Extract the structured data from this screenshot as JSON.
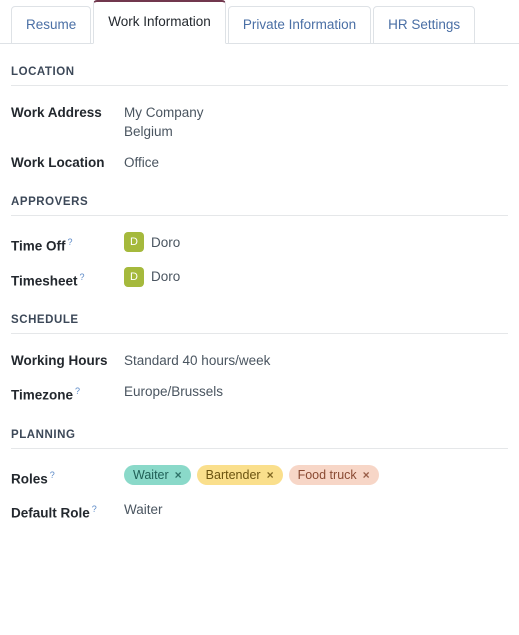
{
  "tabs": [
    {
      "label": "Resume",
      "active": false
    },
    {
      "label": "Work Information",
      "active": true
    },
    {
      "label": "Private Information",
      "active": false
    },
    {
      "label": "HR Settings",
      "active": false
    }
  ],
  "active_tab_accent": "#71374d",
  "sections": [
    {
      "title": "LOCATION",
      "rows": [
        {
          "label": "Work Address",
          "help": false,
          "type": "text-lines",
          "lines": [
            "My Company",
            "Belgium"
          ]
        },
        {
          "label": "Work Location",
          "help": false,
          "type": "text",
          "value": "Office"
        }
      ]
    },
    {
      "title": "APPROVERS",
      "rows": [
        {
          "label": "Time Off",
          "help": true,
          "help_glyph": "?",
          "type": "avatar",
          "avatar_initial": "D",
          "avatar_color": "#a5b93c",
          "value": "Doro"
        },
        {
          "label": "Timesheet",
          "help": true,
          "help_glyph": "?",
          "type": "avatar",
          "avatar_initial": "D",
          "avatar_color": "#a5b93c",
          "value": "Doro"
        }
      ]
    },
    {
      "title": "SCHEDULE",
      "rows": [
        {
          "label": "Working Hours",
          "help": false,
          "type": "text",
          "value": "Standard 40 hours/week"
        },
        {
          "label": "Timezone",
          "help": true,
          "help_glyph": "?",
          "type": "text",
          "value": "Europe/Brussels"
        }
      ]
    },
    {
      "title": "PLANNING",
      "rows": [
        {
          "label": "Roles",
          "help": true,
          "help_glyph": "?",
          "type": "tags",
          "remove_glyph": "×",
          "tags": [
            {
              "label": "Waiter",
              "bg": "#8ad9c9",
              "fg": "#1f5f56"
            },
            {
              "label": "Bartender",
              "bg": "#fadf8c",
              "fg": "#6b5310"
            },
            {
              "label": "Food truck",
              "bg": "#f7d6c7",
              "fg": "#8a4a33"
            }
          ]
        },
        {
          "label": "Default Role",
          "help": true,
          "help_glyph": "?",
          "type": "text",
          "value": "Waiter"
        }
      ]
    }
  ]
}
